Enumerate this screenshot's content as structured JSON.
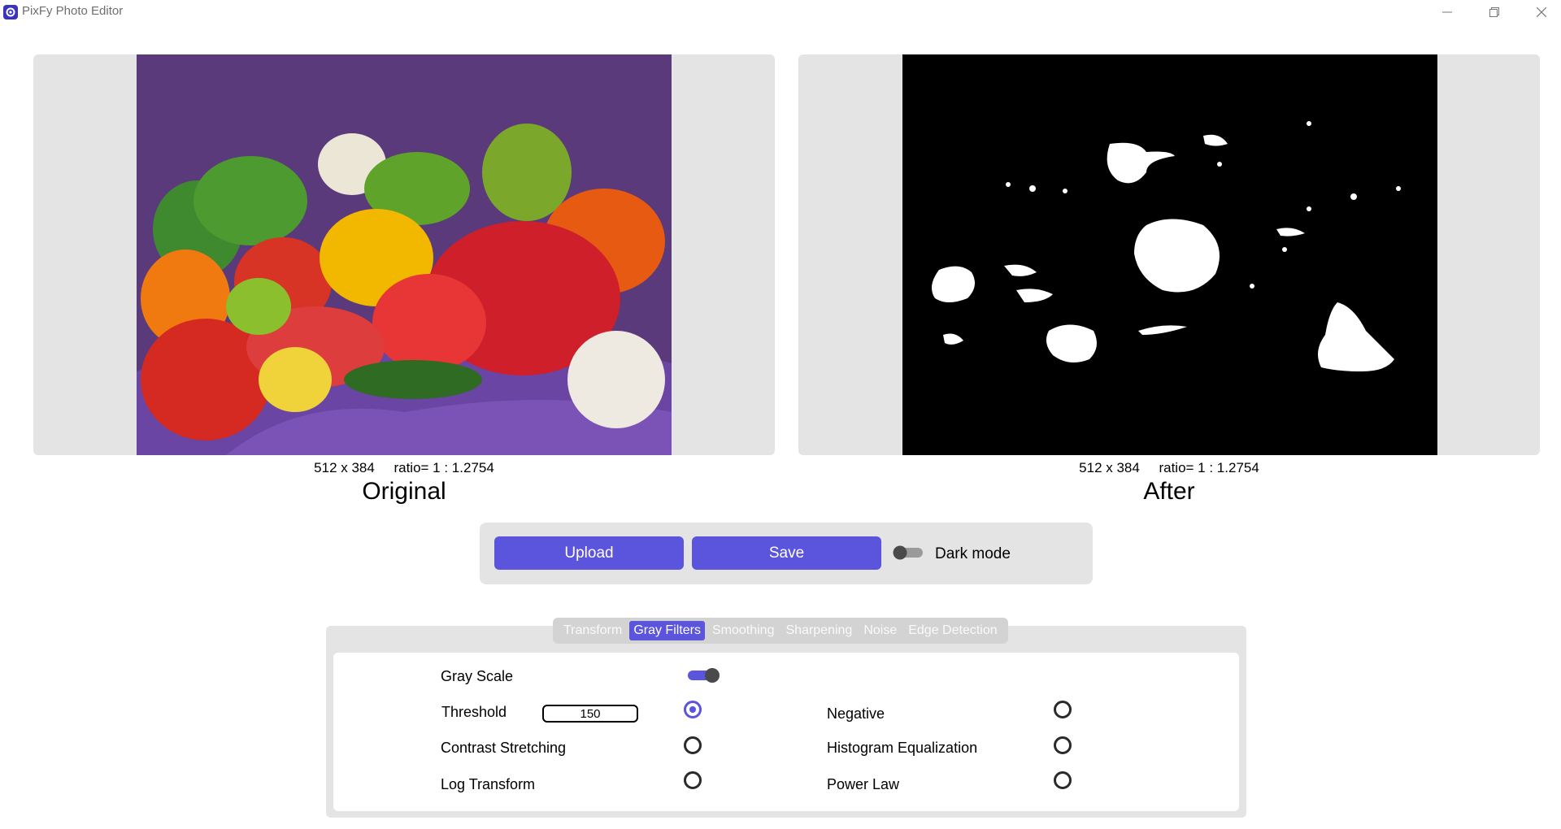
{
  "window": {
    "title": "PixFy Photo Editor"
  },
  "original": {
    "dims": "512 x 384     ratio= 1 : 1.2754",
    "caption": "Original"
  },
  "after": {
    "dims": "512 x 384     ratio= 1 : 1.2754",
    "caption": "After"
  },
  "actions": {
    "upload_label": "Upload",
    "save_label": "Save",
    "dark_mode_label": "Dark mode",
    "dark_mode_on": false
  },
  "tabs": [
    {
      "label": "Transform",
      "active": false
    },
    {
      "label": "Gray Filters",
      "active": true
    },
    {
      "label": "Smoothing",
      "active": false
    },
    {
      "label": "Sharpening",
      "active": false
    },
    {
      "label": "Noise",
      "active": false
    },
    {
      "label": "Edge Detection",
      "active": false
    }
  ],
  "gray_filters": {
    "gray_scale_label": "Gray Scale",
    "gray_scale_on": true,
    "threshold_label": "Threshold",
    "threshold_value": "150",
    "contrast_label": "Contrast Stretching",
    "log_label": "Log Transform",
    "negative_label": "Negative",
    "histogram_label": "Histogram Equalization",
    "power_label": "Power Law",
    "selected": "Threshold"
  },
  "colors": {
    "accent": "#5b54dc",
    "panel": "#e4e4e4"
  }
}
